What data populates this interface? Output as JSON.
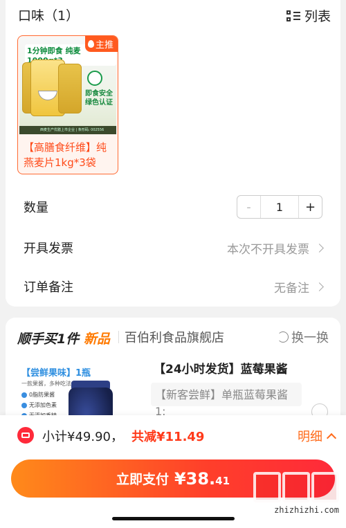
{
  "flavor": {
    "label": "口味（1）",
    "view_toggle_label": "列表"
  },
  "sku": {
    "tag": "主推",
    "image": {
      "banner": "1分钟即食 纯麦1000g*3",
      "green_text": "即食安全 绿色认证",
      "footer": "西麦生产优膳上市企业 | 条形码: 002556"
    },
    "name": "【高膳食纤维】纯燕麦片1kg*3袋"
  },
  "quantity": {
    "label": "数量",
    "minus": "-",
    "value": "1",
    "plus": "+"
  },
  "invoice": {
    "label": "开具发票",
    "value": "本次不开具发票"
  },
  "remark": {
    "label": "订单备注",
    "value": "无备注"
  },
  "addon": {
    "title": "顺手买1件",
    "new_badge": "新品",
    "store": "百伯利食品旗舰店",
    "swap_label": "换一换",
    "product": {
      "img_head": "【尝鲜果味】1瓶",
      "img_sub": "一款果酱，多种吃法",
      "features": [
        "0脂防果酱",
        "无添加色素",
        "无添加香精"
      ],
      "title": "【24小时发货】蓝莓果酱",
      "subtitle": "【新客尝鲜】单瓶蓝莓果酱",
      "subtitle_extra": "1:"
    }
  },
  "summary": {
    "subtotal": "小计¥49.90，",
    "discount": "共减¥11.49",
    "detail_label": "明细"
  },
  "pay": {
    "label": "立即支付",
    "amount": "¥38.",
    "cents": "41"
  },
  "watermark": {
    "url": "zhizhizhi.com"
  },
  "colors": {
    "accent": "#ff4b1a",
    "pay_start": "#ff8a1a",
    "pay_end": "#ff2a3a",
    "new_badge": "#ff7a00"
  }
}
